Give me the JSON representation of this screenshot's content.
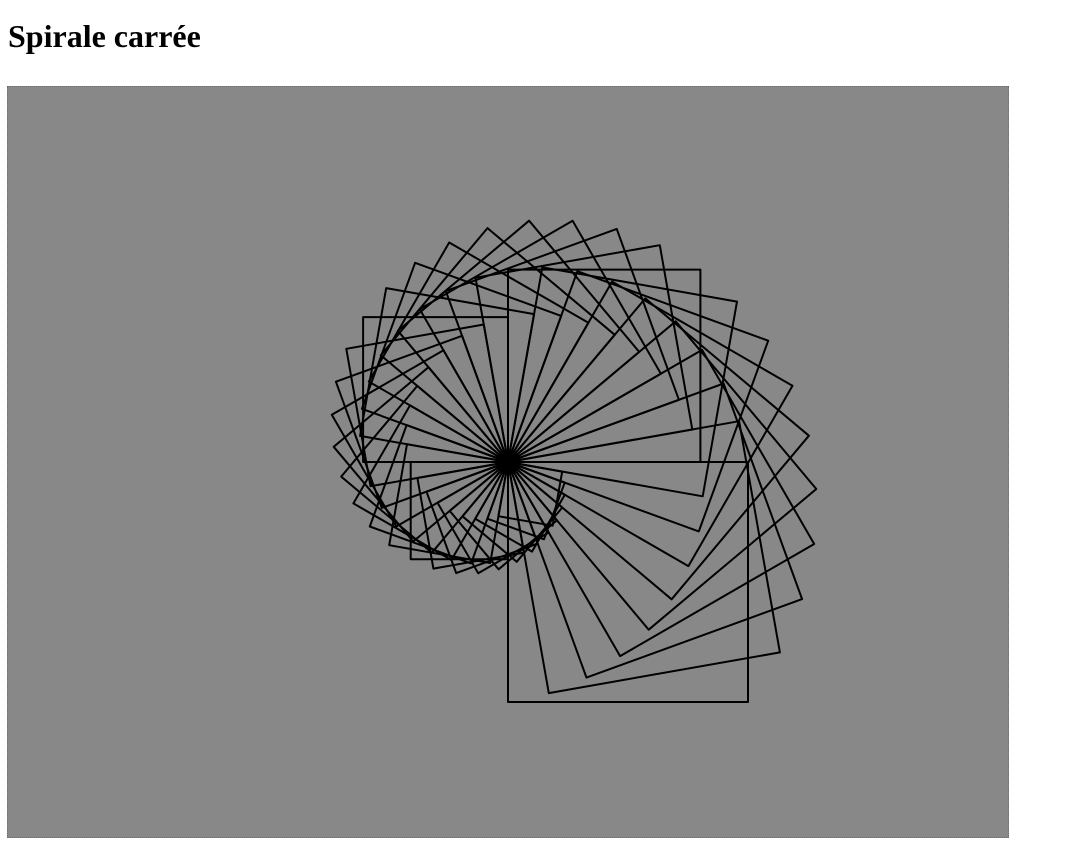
{
  "page": {
    "title": "Spirale carrée"
  },
  "canvas": {
    "background_color": "#888888",
    "stroke_color": "#000000"
  },
  "spiral": {
    "shape": "square",
    "square_count": 36,
    "rotation_step_degrees": 10,
    "size_start": 55,
    "size_end": 240
  }
}
